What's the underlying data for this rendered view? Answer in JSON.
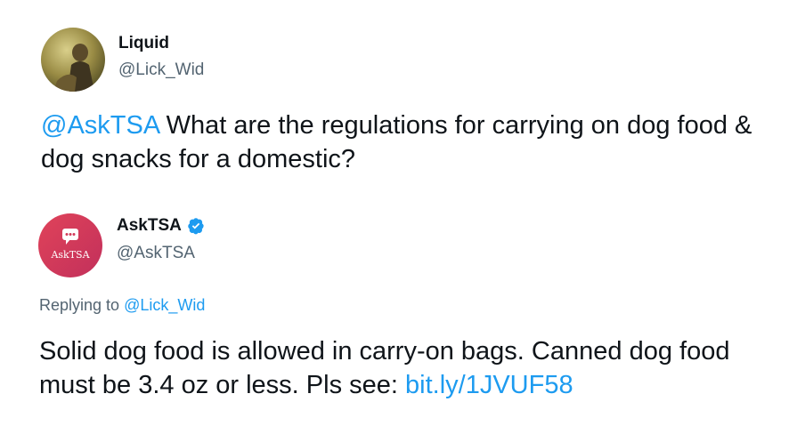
{
  "tweet1": {
    "name": "Liquid",
    "handle": "@Lick_Wid",
    "mention": "@AskTSA",
    "text_rest": " What are the regulations for carrying on dog food & dog snacks for a domestic?"
  },
  "tweet2": {
    "name": "AskTSA",
    "handle": "@AskTSA",
    "avatar_label": "AskTSA",
    "verified_icon": "verified-badge-icon",
    "reply_prefix": "Replying to ",
    "reply_to": "@Lick_Wid",
    "text_before_link": "Solid dog food is allowed in carry-on bags. Canned dog food must be 3.4 oz or less. Pls see: ",
    "link": "bit.ly/1JVUF58"
  },
  "colors": {
    "link": "#1d9bf0",
    "secondary_text": "#536471",
    "verified": "#1d9bf0",
    "asktsa_avatar_start": "#e0435a",
    "asktsa_avatar_end": "#c2305b"
  }
}
